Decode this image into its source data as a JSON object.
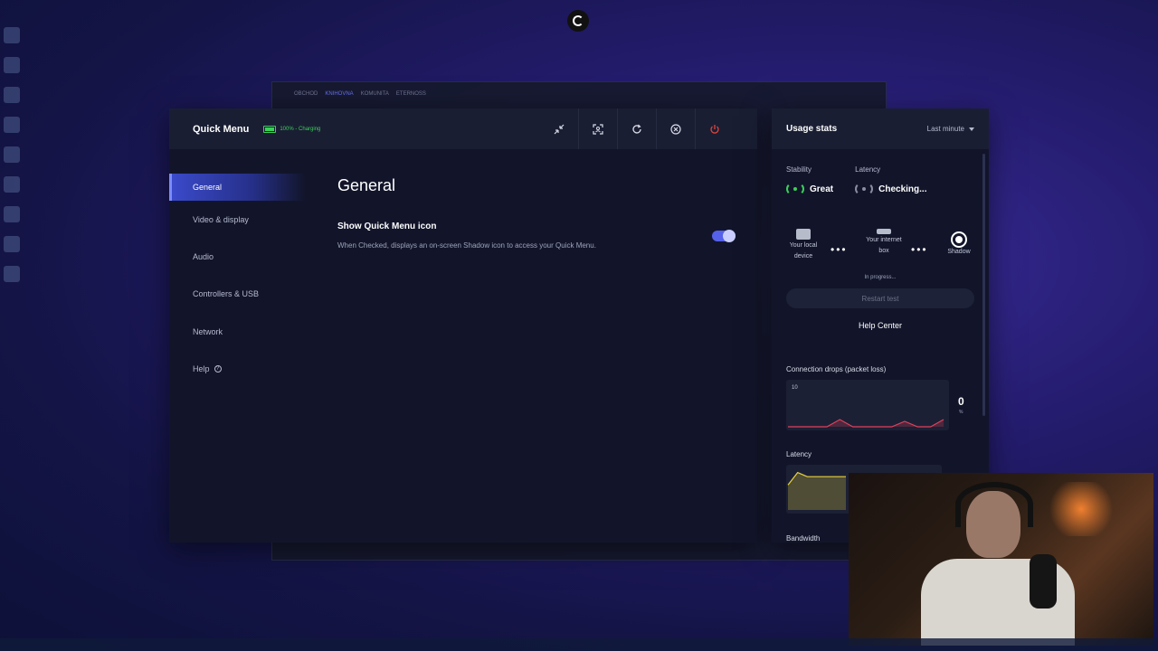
{
  "background_window": {
    "tabs": [
      "OBCHOD",
      "KNIHOVNA",
      "KOMUNITA",
      "ETERNOSS"
    ]
  },
  "quick_menu": {
    "title": "Quick Menu",
    "battery": "100% - Charging",
    "actions": [
      "minimize-icon",
      "screenshot-icon",
      "refresh-icon",
      "close-icon",
      "power-icon"
    ]
  },
  "sidebar": {
    "items": [
      {
        "label": "General",
        "active": true
      },
      {
        "label": "Video & display"
      },
      {
        "label": "Audio"
      },
      {
        "label": "Controllers & USB"
      },
      {
        "label": "Network"
      },
      {
        "label": "Help"
      }
    ]
  },
  "content": {
    "heading": "General",
    "setting": {
      "title": "Show Quick Menu icon",
      "description": "When Checked, displays an on-screen Shadow icon to access your Quick Menu.",
      "enabled": true
    }
  },
  "usage": {
    "title": "Usage stats",
    "period": "Last minute",
    "stability_label": "Stability",
    "stability_value": "Great",
    "latency_label": "Latency",
    "latency_value": "Checking...",
    "route": {
      "local": "Your local device",
      "box": "Your internet box",
      "shadow": "Shadow"
    },
    "progress": "In progress...",
    "restart": "Restart test",
    "help_center": "Help Center",
    "drops_title": "Connection drops (packet loss)",
    "drops_axis_max": "10",
    "drops_value": "0",
    "drops_unit": "%",
    "latency_chart_title": "Latency",
    "bandwidth_title": "Bandwidth"
  },
  "colors": {
    "accent": "#5561e8",
    "good": "#3ccf5a",
    "drop_line": "#e0405a",
    "latency_line": "#e8d23c",
    "power": "#e0443d"
  },
  "chart_data": [
    {
      "type": "area",
      "title": "Connection drops (packet loss)",
      "ylim": [
        0,
        10
      ],
      "x": [
        0,
        5,
        10,
        15,
        20,
        25,
        30,
        35,
        40,
        45,
        50,
        55,
        60
      ],
      "values": [
        0,
        0,
        0,
        0,
        2,
        0,
        0,
        0,
        0,
        1.5,
        0,
        0,
        2
      ]
    },
    {
      "type": "area",
      "title": "Latency",
      "x": [
        0,
        5,
        10,
        15,
        20,
        25,
        30
      ],
      "values": [
        6,
        9,
        8,
        8,
        8,
        8,
        8
      ]
    }
  ]
}
